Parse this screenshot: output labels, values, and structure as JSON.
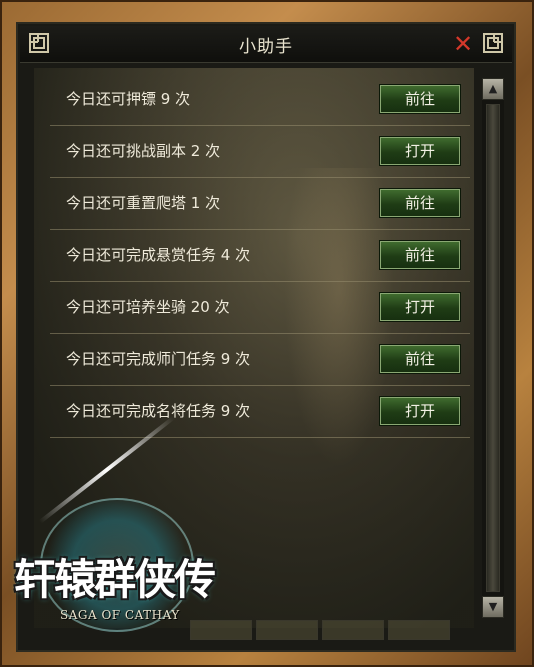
{
  "window": {
    "title": "小助手"
  },
  "tasks": [
    {
      "label": "今日还可押镖 9 次",
      "button": "前往"
    },
    {
      "label": "今日还可挑战副本 2 次",
      "button": "打开"
    },
    {
      "label": "今日还可重置爬塔 1 次",
      "button": "前往"
    },
    {
      "label": "今日还可完成悬赏任务 4 次",
      "button": "前往"
    },
    {
      "label": "今日还可培养坐骑 20 次",
      "button": "打开"
    },
    {
      "label": "今日还可完成师门任务 9 次",
      "button": "前往"
    },
    {
      "label": "今日还可完成名将任务 9 次",
      "button": "打开"
    }
  ],
  "logo": {
    "title": "轩辕群侠传",
    "subtitle": "SAGA OF CATHAY"
  },
  "icons": {
    "close": "close-icon",
    "scroll_up": "triangle-up-icon",
    "scroll_down": "triangle-down-icon"
  },
  "colors": {
    "button_green": "#2f5522",
    "close_red": "#d4382a",
    "frame_gold": "#b8823f"
  }
}
